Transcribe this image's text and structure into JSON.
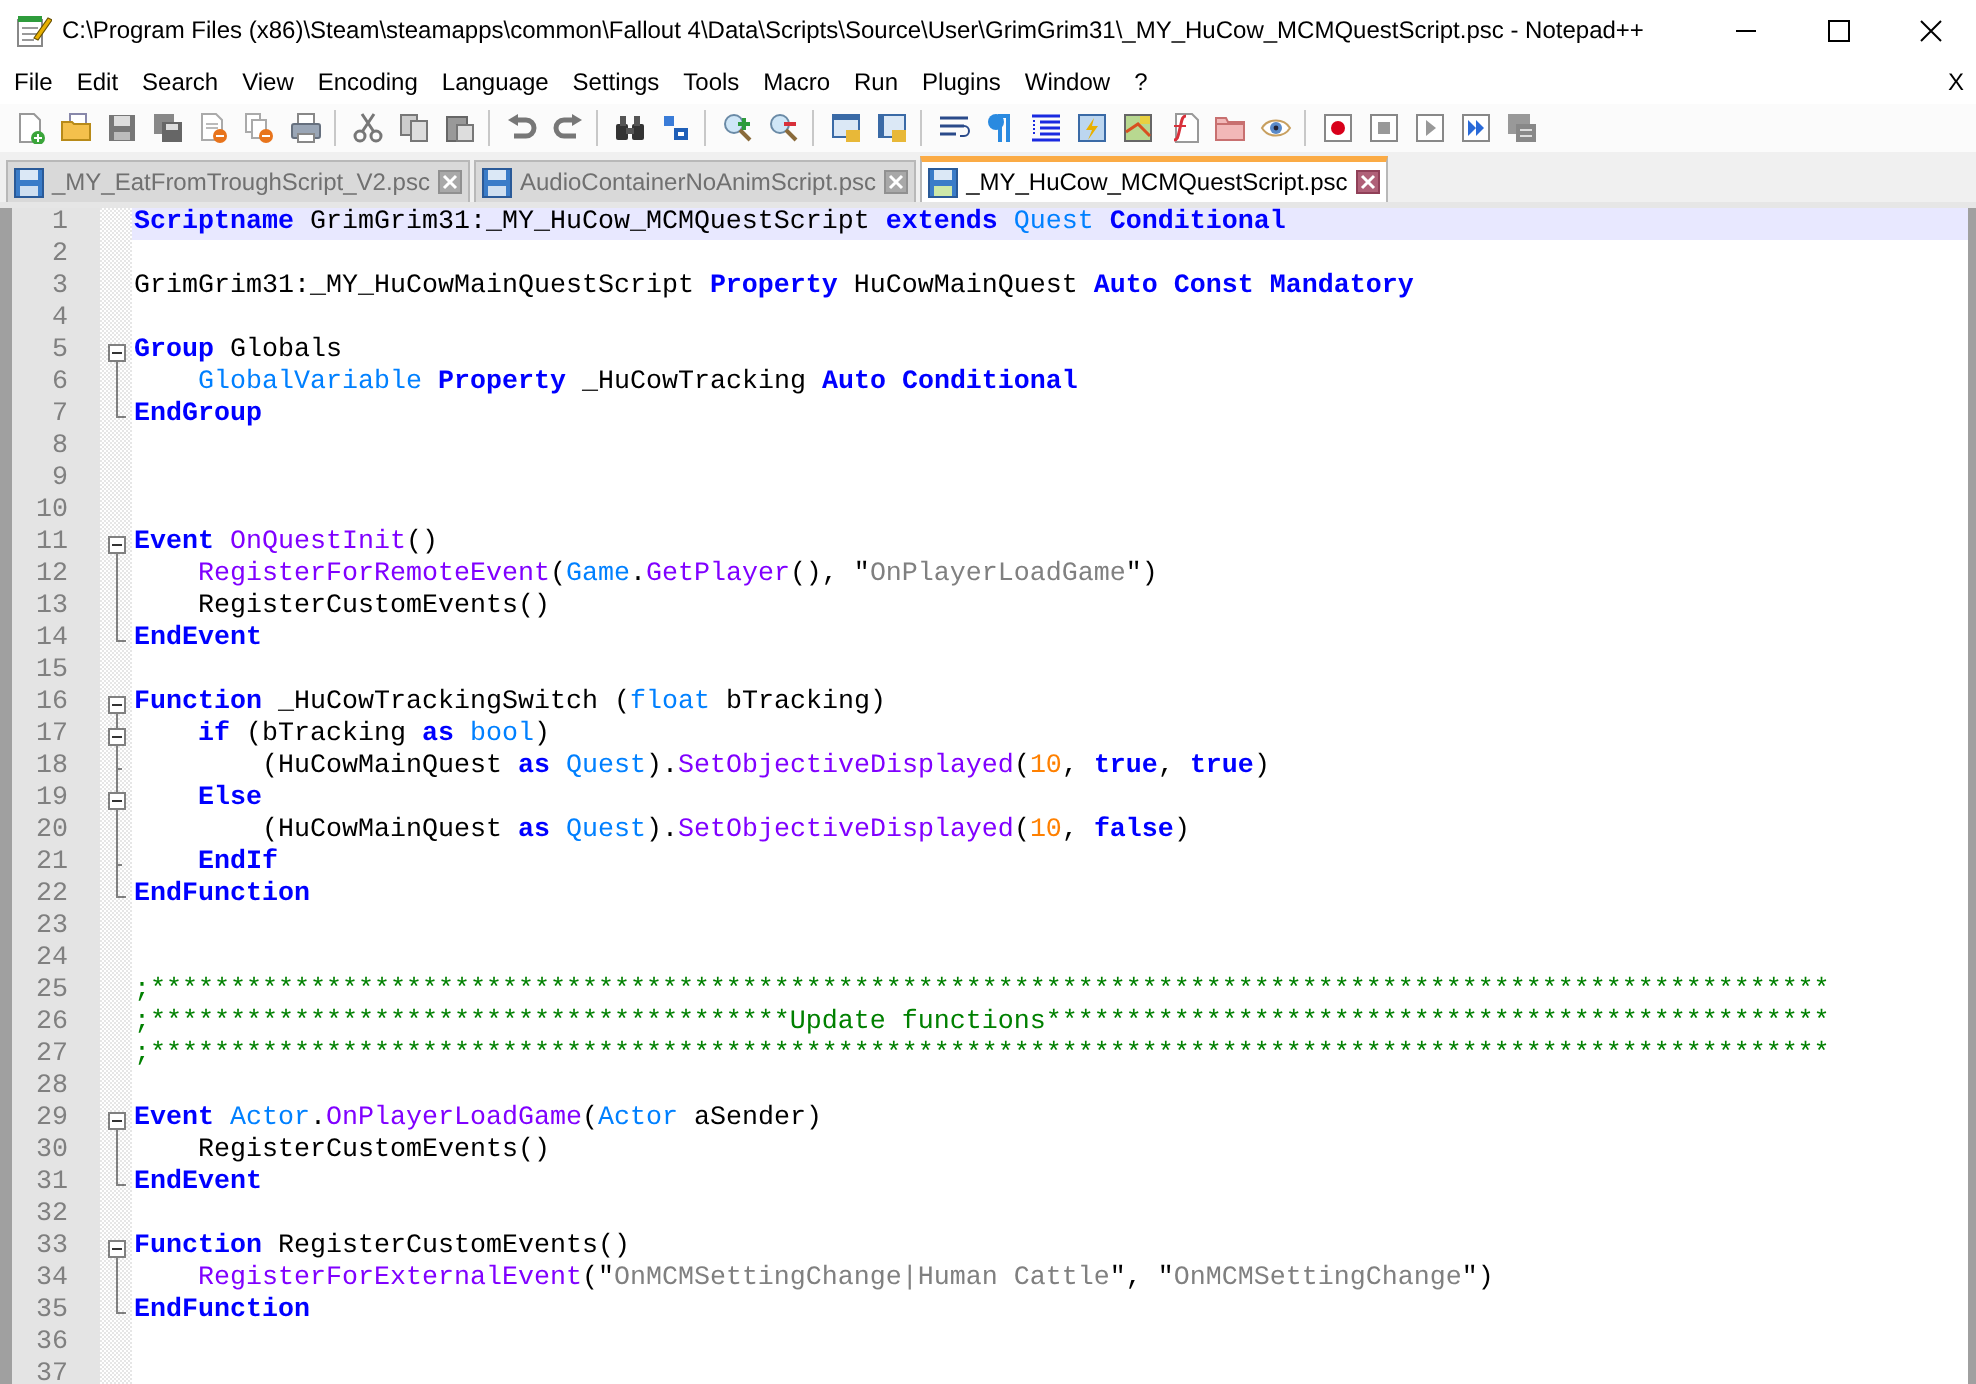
{
  "window": {
    "title": "C:\\Program Files (x86)\\Steam\\steamapps\\common\\Fallout 4\\Data\\Scripts\\Source\\User\\GrimGrim31\\_MY_HuCow_MCMQuestScript.psc - Notepad++"
  },
  "menu": {
    "items": [
      "File",
      "Edit",
      "Search",
      "View",
      "Encoding",
      "Language",
      "Settings",
      "Tools",
      "Macro",
      "Run",
      "Plugins",
      "Window",
      "?"
    ],
    "close_label": "X"
  },
  "tabs": [
    {
      "label": "_MY_EatFromTroughScript_V2.psc",
      "selected": false
    },
    {
      "label": "AudioContainerNoAnimScript.psc",
      "selected": false
    },
    {
      "label": "_MY_HuCow_MCMQuestScript.psc",
      "selected": true
    }
  ],
  "editor": {
    "lines": [
      {
        "number": "1",
        "current": true,
        "tokens": [
          {
            "kind": "keyword",
            "text": "Scriptname"
          },
          {
            "kind": "plain",
            "text": " GrimGrim31:_MY_HuCow_MCMQuestScript "
          },
          {
            "kind": "keyword",
            "text": "extends "
          },
          {
            "kind": "type",
            "text": "Quest "
          },
          {
            "kind": "keyword",
            "text": "Conditional"
          }
        ]
      },
      {
        "number": "2",
        "current": false
      },
      {
        "number": "3",
        "current": false,
        "tokens": [
          {
            "kind": "plain",
            "text": "GrimGrim31:_MY_HuCowMainQuestScript "
          },
          {
            "kind": "keyword",
            "text": "Property"
          },
          {
            "kind": "plain",
            "text": " HuCowMainQuest "
          },
          {
            "kind": "keyword",
            "text": "Auto Const Mandatory"
          }
        ]
      },
      {
        "number": "4",
        "current": false
      },
      {
        "number": "5",
        "current": false,
        "fold": {
          "kind": "start"
        },
        "tokens": [
          {
            "kind": "keyword",
            "text": "Group"
          },
          {
            "kind": "plain",
            "text": " Globals"
          }
        ]
      },
      {
        "number": "6",
        "current": false,
        "fold": {
          "kind": "inside"
        },
        "tokens": [
          {
            "kind": "type",
            "text": "    GlobalVariable "
          },
          {
            "kind": "keyword",
            "text": "Property"
          },
          {
            "kind": "plain",
            "text": " _HuCowTracking "
          },
          {
            "kind": "keyword",
            "text": "Auto Conditional"
          }
        ]
      },
      {
        "number": "7",
        "current": false,
        "fold": {
          "kind": "end"
        },
        "tokens": [
          {
            "kind": "keyword",
            "text": "EndGroup"
          }
        ]
      },
      {
        "number": "8",
        "current": false
      },
      {
        "number": "9",
        "current": false
      },
      {
        "number": "10",
        "current": false
      },
      {
        "number": "11",
        "current": false,
        "fold": {
          "kind": "start"
        },
        "tokens": [
          {
            "kind": "keyword",
            "text": "Event "
          },
          {
            "kind": "function",
            "text": "OnQuestInit"
          },
          {
            "kind": "plain",
            "text": "()"
          }
        ]
      },
      {
        "number": "12",
        "current": false,
        "fold": {
          "kind": "inside"
        },
        "tokens": [
          {
            "kind": "function",
            "text": "    RegisterForRemoteEvent"
          },
          {
            "kind": "plain",
            "text": "("
          },
          {
            "kind": "type",
            "text": "Game"
          },
          {
            "kind": "plain",
            "text": "."
          },
          {
            "kind": "function",
            "text": "GetPlayer"
          },
          {
            "kind": "plain",
            "text": "(), \""
          },
          {
            "kind": "string",
            "text": "OnPlayerLoadGame"
          },
          {
            "kind": "plain",
            "text": "\")"
          }
        ]
      },
      {
        "number": "13",
        "current": false,
        "fold": {
          "kind": "inside"
        },
        "tokens": [
          {
            "kind": "plain",
            "text": "    RegisterCustomEvents()"
          }
        ]
      },
      {
        "number": "14",
        "current": false,
        "fold": {
          "kind": "end"
        },
        "tokens": [
          {
            "kind": "keyword",
            "text": "EndEvent"
          }
        ]
      },
      {
        "number": "15",
        "current": false
      },
      {
        "number": "16",
        "current": false,
        "fold": {
          "kind": "start"
        },
        "tokens": [
          {
            "kind": "keyword",
            "text": "Function"
          },
          {
            "kind": "plain",
            "text": " _HuCowTrackingSwitch ("
          },
          {
            "kind": "type",
            "text": "float"
          },
          {
            "kind": "plain",
            "text": " bTracking)"
          }
        ]
      },
      {
        "number": "17",
        "current": false,
        "fold": {
          "kind": "start"
        },
        "tokens": [
          {
            "kind": "keyword",
            "text": "    if"
          },
          {
            "kind": "plain",
            "text": " (bTracking "
          },
          {
            "kind": "keyword",
            "text": "as "
          },
          {
            "kind": "type",
            "text": "bool"
          },
          {
            "kind": "plain",
            "text": ")"
          }
        ]
      },
      {
        "number": "18",
        "current": false,
        "fold": {
          "kind": "branch"
        },
        "tokens": [
          {
            "kind": "plain",
            "text": "        (HuCowMainQuest "
          },
          {
            "kind": "keyword",
            "text": "as "
          },
          {
            "kind": "type",
            "text": "Quest"
          },
          {
            "kind": "plain",
            "text": ")."
          },
          {
            "kind": "function",
            "text": "SetObjectiveDisplayed"
          },
          {
            "kind": "plain",
            "text": "("
          },
          {
            "kind": "number",
            "text": "10"
          },
          {
            "kind": "plain",
            "text": ", "
          },
          {
            "kind": "keyword",
            "text": "true"
          },
          {
            "kind": "plain",
            "text": ", "
          },
          {
            "kind": "keyword",
            "text": "true"
          },
          {
            "kind": "plain",
            "text": ")"
          }
        ]
      },
      {
        "number": "19",
        "current": false,
        "fold": {
          "kind": "start"
        },
        "tokens": [
          {
            "kind": "keyword",
            "text": "    Else"
          }
        ]
      },
      {
        "number": "20",
        "current": false,
        "fold": {
          "kind": "inside"
        },
        "tokens": [
          {
            "kind": "plain",
            "text": "        (HuCowMainQuest "
          },
          {
            "kind": "keyword",
            "text": "as "
          },
          {
            "kind": "type",
            "text": "Quest"
          },
          {
            "kind": "plain",
            "text": ")."
          },
          {
            "kind": "function",
            "text": "SetObjectiveDisplayed"
          },
          {
            "kind": "plain",
            "text": "("
          },
          {
            "kind": "number",
            "text": "10"
          },
          {
            "kind": "plain",
            "text": ", "
          },
          {
            "kind": "keyword",
            "text": "false"
          },
          {
            "kind": "plain",
            "text": ")"
          }
        ]
      },
      {
        "number": "21",
        "current": false,
        "fold": {
          "kind": "branch"
        },
        "tokens": [
          {
            "kind": "keyword",
            "text": "    EndIf"
          }
        ]
      },
      {
        "number": "22",
        "current": false,
        "fold": {
          "kind": "end"
        },
        "tokens": [
          {
            "kind": "keyword",
            "text": "EndFunction"
          }
        ]
      },
      {
        "number": "23",
        "current": false
      },
      {
        "number": "24",
        "current": false
      },
      {
        "number": "25",
        "current": false,
        "tokens": [
          {
            "kind": "comment",
            "text": ";*********************************************************************************************************"
          }
        ]
      },
      {
        "number": "26",
        "current": false,
        "tokens": [
          {
            "kind": "comment",
            "text": ";****************************************Update functions*************************************************"
          }
        ]
      },
      {
        "number": "27",
        "current": false,
        "tokens": [
          {
            "kind": "comment",
            "text": ";*********************************************************************************************************"
          }
        ]
      },
      {
        "number": "28",
        "current": false
      },
      {
        "number": "29",
        "current": false,
        "fold": {
          "kind": "start"
        },
        "tokens": [
          {
            "kind": "keyword",
            "text": "Event "
          },
          {
            "kind": "type",
            "text": "Actor"
          },
          {
            "kind": "plain",
            "text": "."
          },
          {
            "kind": "function",
            "text": "OnPlayerLoadGame"
          },
          {
            "kind": "plain",
            "text": "("
          },
          {
            "kind": "type",
            "text": "Actor"
          },
          {
            "kind": "plain",
            "text": " aSender)"
          }
        ]
      },
      {
        "number": "30",
        "current": false,
        "fold": {
          "kind": "inside"
        },
        "tokens": [
          {
            "kind": "plain",
            "text": "    RegisterCustomEvents()"
          }
        ]
      },
      {
        "number": "31",
        "current": false,
        "fold": {
          "kind": "end"
        },
        "tokens": [
          {
            "kind": "keyword",
            "text": "EndEvent"
          }
        ]
      },
      {
        "number": "32",
        "current": false
      },
      {
        "number": "33",
        "current": false,
        "fold": {
          "kind": "start"
        },
        "tokens": [
          {
            "kind": "keyword",
            "text": "Function"
          },
          {
            "kind": "plain",
            "text": " RegisterCustomEvents()"
          }
        ]
      },
      {
        "number": "34",
        "current": false,
        "fold": {
          "kind": "inside"
        },
        "tokens": [
          {
            "kind": "function",
            "text": "    RegisterForExternalEvent"
          },
          {
            "kind": "plain",
            "text": "(\""
          },
          {
            "kind": "string",
            "text": "OnMCMSettingChange|Human Cattle"
          },
          {
            "kind": "plain",
            "text": "\", \""
          },
          {
            "kind": "string",
            "text": "OnMCMSettingChange"
          },
          {
            "kind": "plain",
            "text": "\")"
          }
        ]
      },
      {
        "number": "35",
        "current": false,
        "fold": {
          "kind": "end"
        },
        "tokens": [
          {
            "kind": "keyword",
            "text": "EndFunction"
          }
        ]
      },
      {
        "number": "36",
        "current": false
      },
      {
        "number": "37",
        "current": false
      }
    ]
  }
}
